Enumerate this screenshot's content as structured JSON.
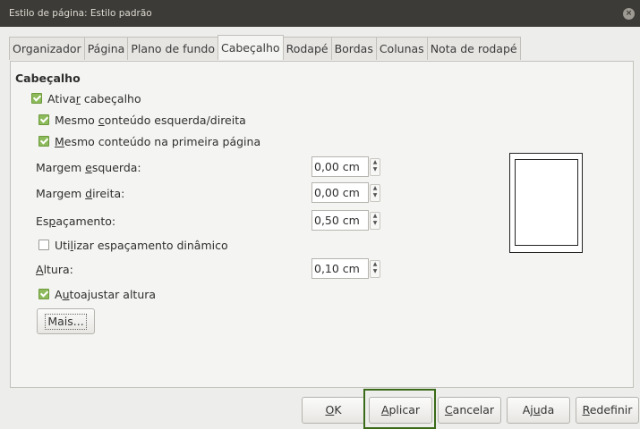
{
  "window": {
    "title": "Estilo de página: Estilo padrão",
    "close_icon": "close-icon"
  },
  "tabs": [
    {
      "label": "Organizador",
      "active": false
    },
    {
      "label": "Página",
      "active": false
    },
    {
      "label": "Plano de fundo",
      "active": false
    },
    {
      "label": "Cabeçalho",
      "active": true
    },
    {
      "label": "Rodapé",
      "active": false
    },
    {
      "label": "Bordas",
      "active": false
    },
    {
      "label": "Colunas",
      "active": false
    },
    {
      "label": "Nota de rodapé",
      "active": false
    }
  ],
  "header": {
    "section_title": "Cabeçalho",
    "enable": {
      "pre": "Ativa",
      "u": "r",
      "post": " cabeçalho",
      "checked": true
    },
    "same_lr": {
      "pre": "Mesmo ",
      "u": "c",
      "post": "onteúdo esquerda/direita",
      "checked": true
    },
    "same_first": {
      "pre": "",
      "u": "M",
      "post": "esmo conteúdo na primeira página",
      "checked": true
    },
    "left_margin": {
      "pre": "Margem ",
      "u": "e",
      "post": "squerda:",
      "value": "0,00 cm"
    },
    "right_margin": {
      "pre": "Margem ",
      "u": "d",
      "post": "ireita:",
      "value": "0,00 cm"
    },
    "spacing": {
      "pre": "Es",
      "u": "p",
      "post": "açamento:",
      "value": "0,50 cm"
    },
    "dynamic_spacing": {
      "pre": "Uti",
      "u": "l",
      "post": "izar espaçamento dinâmico",
      "checked": false
    },
    "height": {
      "pre": "",
      "u": "A",
      "post": "ltura:",
      "value": "0,10 cm"
    },
    "autofit": {
      "pre": "A",
      "u": "u",
      "post": "toajustar altura",
      "checked": true
    },
    "more_button": "Mais..."
  },
  "buttons": {
    "ok": {
      "pre": "",
      "u": "O",
      "post": "K"
    },
    "apply": {
      "pre": "",
      "u": "A",
      "post": "plicar"
    },
    "cancel": {
      "pre": "",
      "u": "C",
      "post": "ancelar"
    },
    "help": {
      "pre": "Aj",
      "u": "u",
      "post": "da"
    },
    "reset": {
      "pre": "",
      "u": "R",
      "post": "edefinir"
    }
  }
}
